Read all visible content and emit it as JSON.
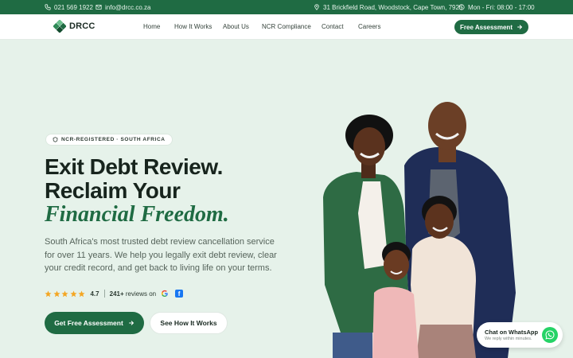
{
  "topbar": {
    "phone": "021 569 1922",
    "email": "info@drcc.co.za",
    "address": "31 Brickfield Road, Woodstock, Cape Town, 7925",
    "hours": "Mon - Fri: 08:00 - 17:00"
  },
  "nav": {
    "logo": "DRCC",
    "links": [
      "Home",
      "How It Works",
      "About Us",
      "NCR Compliance",
      "Contact",
      "Careers"
    ],
    "cta": "Free Assessment"
  },
  "hero": {
    "badge": "NCR-REGISTERED · SOUTH AFRICA",
    "title_line1": "Exit Debt Review.",
    "title_line2": "Reclaim Your",
    "title_accent": "Financial Freedom.",
    "lead": "South Africa's most trusted debt review cancellation service for over 11 years. We help you legally exit debt review, clear your credit record, and get back to living life on your terms.",
    "rating": {
      "stars": 5,
      "score": "4.7",
      "count": "241+",
      "reviews_text": "reviews on"
    },
    "primary_cta": "Get Free Assessment",
    "secondary_cta": "See How It Works"
  },
  "whatsapp": {
    "title": "Chat on WhatsApp",
    "subtitle": "We reply within minutes."
  },
  "colors": {
    "brand_green": "#1f6b43",
    "hero_bg": "#e6f2ea",
    "star": "#f4a623"
  }
}
